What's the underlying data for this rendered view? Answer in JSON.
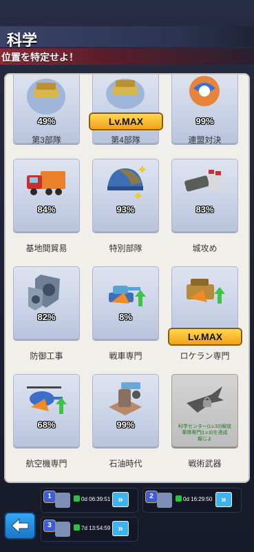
{
  "header": {
    "title": "科学",
    "subtitle": "位置を特定せよ！"
  },
  "cards": [
    {
      "pct": "49%",
      "label": "第3部隊",
      "badge": ""
    },
    {
      "pct": "",
      "label": "第4部隊",
      "badge": "Lv.MAX"
    },
    {
      "pct": "99%",
      "label": "連盟対決",
      "badge": ""
    },
    {
      "pct": "84%",
      "label": "基地間貿易",
      "badge": ""
    },
    {
      "pct": "93%",
      "label": "特別部隊",
      "badge": ""
    },
    {
      "pct": "83%",
      "label": "城攻め",
      "badge": ""
    },
    {
      "pct": "82%",
      "label": "防御工事",
      "badge": ""
    },
    {
      "pct": "8%",
      "label": "戦車専門",
      "badge": ""
    },
    {
      "pct": "",
      "label": "ロケラン専門",
      "badge": "Lv.MAX"
    },
    {
      "pct": "68%",
      "label": "航空機専門",
      "badge": ""
    },
    {
      "pct": "99%",
      "label": "石油時代",
      "badge": ""
    },
    {
      "pct": "",
      "label": "戦術武器",
      "badge": "",
      "lock_lines": [
        "科学センター(Lv.33)解放",
        "軍隊専門(Lv.8)を達成",
        "報じよ"
      ]
    }
  ],
  "queues": [
    {
      "num": "1",
      "time": "0d 06:39:51"
    },
    {
      "num": "2",
      "time": "0d 16:29:50"
    },
    {
      "num": "3",
      "time": "7d 13:54:59"
    }
  ],
  "colors": {
    "accent": "#f2a21a",
    "queue_button": "#3fb3f0",
    "back_button": "#1a76c8"
  },
  "icons": [
    "fast-forward-icon",
    "back-arrow-icon",
    "lock-icon"
  ]
}
